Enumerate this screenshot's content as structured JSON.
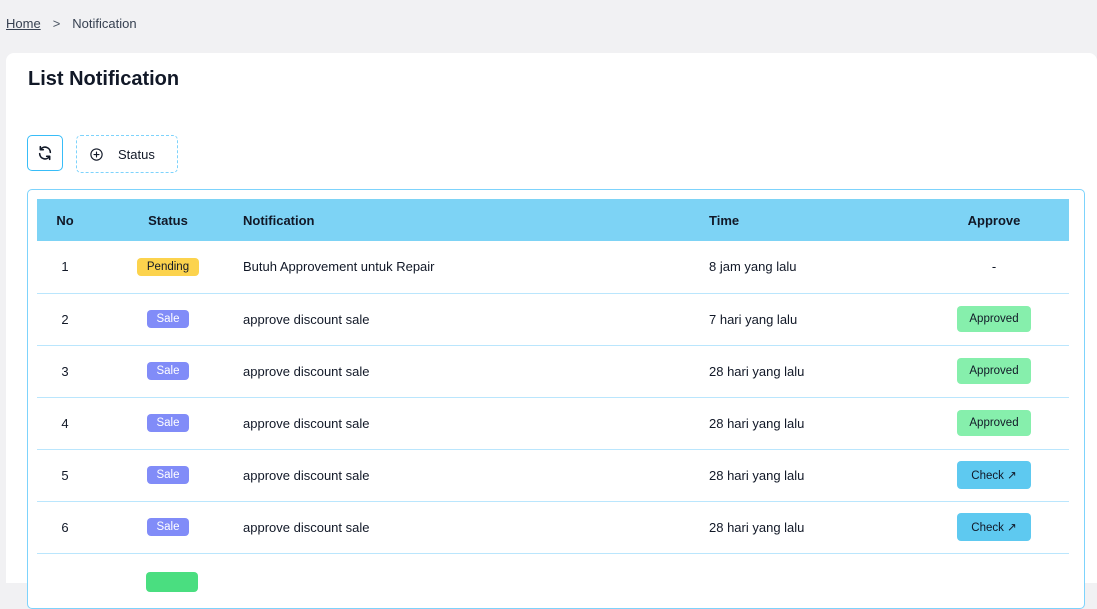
{
  "breadcrumb": {
    "home": "Home",
    "separator": ">",
    "current": "Notification"
  },
  "page": {
    "title": "List Notification"
  },
  "toolbar": {
    "refresh_icon": "refresh-icon",
    "filter_icon": "plus-circle-icon",
    "status_filter_label": "Status"
  },
  "table": {
    "headers": {
      "no": "No",
      "status": "Status",
      "notification": "Notification",
      "time": "Time",
      "approve": "Approve"
    },
    "rows": [
      {
        "no": "1",
        "status": "Pending",
        "notification": "Butuh Approvement untuk Repair",
        "time": "8 jam yang lalu",
        "approve": "-"
      },
      {
        "no": "2",
        "status": "Sale",
        "notification": "approve discount sale",
        "time": "7 hari yang lalu",
        "approve": "Approved"
      },
      {
        "no": "3",
        "status": "Sale",
        "notification": "approve discount sale",
        "time": "28 hari yang lalu",
        "approve": "Approved"
      },
      {
        "no": "4",
        "status": "Sale",
        "notification": "approve discount sale",
        "time": "28 hari yang lalu",
        "approve": "Approved"
      },
      {
        "no": "5",
        "status": "Sale",
        "notification": "approve discount sale",
        "time": "28 hari yang lalu",
        "approve": "Check ↗"
      },
      {
        "no": "6",
        "status": "Sale",
        "notification": "approve discount sale",
        "time": "28 hari yang lalu",
        "approve": "Check ↗"
      }
    ]
  },
  "colors": {
    "header_bg": "#7dd3f5",
    "pending": "#fcd34d",
    "sale": "#818cf8",
    "approved": "#86efac",
    "check": "#5ec9f0",
    "border": "#7dd3fc"
  }
}
